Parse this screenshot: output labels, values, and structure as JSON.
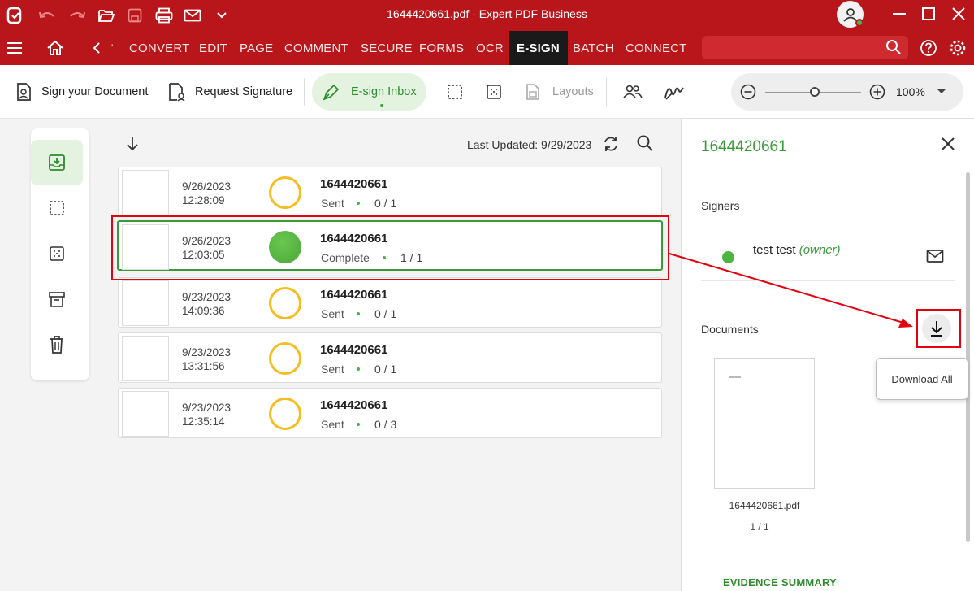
{
  "window": {
    "title": "1644420661.pdf   -   Expert PDF Business",
    "icons": [
      "app-logo-icon",
      "undo-icon",
      "redo-icon",
      "open-folder-icon",
      "save-icon",
      "print-icon",
      "mail-icon",
      "chevron-down-icon"
    ]
  },
  "menu": {
    "items": [
      "CONVERT",
      "EDIT",
      "PAGE",
      "COMMENT",
      "SECURE",
      "FORMS",
      "OCR",
      "E-SIGN",
      "BATCH",
      "CONNECT"
    ],
    "active": "E-SIGN",
    "search_placeholder": ""
  },
  "toolbar": {
    "sign_document": "Sign your Document",
    "request_signature": "Request Signature",
    "esign_inbox": "E-sign Inbox",
    "layouts": "Layouts",
    "zoom": "100%"
  },
  "list": {
    "last_updated": "Last Updated: 9/29/2023",
    "items": [
      {
        "date": "9/26/2023",
        "time": "12:28:09",
        "name": "1644420661",
        "status": "Sent",
        "count": "0 / 1",
        "complete": false
      },
      {
        "date": "9/26/2023",
        "time": "12:03:05",
        "name": "1644420661",
        "status": "Complete",
        "count": "1 / 1",
        "complete": true
      },
      {
        "date": "9/23/2023",
        "time": "14:09:36",
        "name": "1644420661",
        "status": "Sent",
        "count": "0 / 1",
        "complete": false
      },
      {
        "date": "9/23/2023",
        "time": "13:31:56",
        "name": "1644420661",
        "status": "Sent",
        "count": "0 / 1",
        "complete": false
      },
      {
        "date": "9/23/2023",
        "time": "12:35:14",
        "name": "1644420661",
        "status": "Sent",
        "count": "0 / 3",
        "complete": false
      }
    ]
  },
  "panel": {
    "title": "1644420661",
    "signers_label": "Signers",
    "signer_name": "test test",
    "signer_role": "(owner)",
    "documents_label": "Documents",
    "download_tooltip": "Download All",
    "doc_filename": "1644420661.pdf",
    "doc_pages": "1 / 1",
    "evidence": "EVIDENCE SUMMARY"
  },
  "colors": {
    "brand_red": "#b8161b",
    "accent_green": "#3a9a3a",
    "pending_yellow": "#f5bd1f",
    "annotation_red": "#e3000f"
  }
}
